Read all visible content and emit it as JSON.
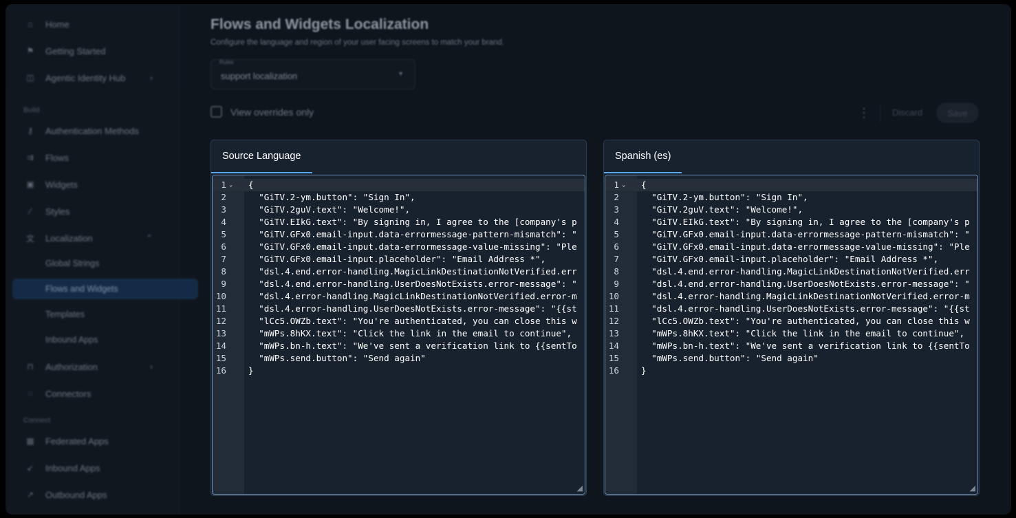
{
  "sidebar": {
    "items": [
      {
        "label": "Home",
        "icon": "home-icon"
      },
      {
        "label": "Getting Started",
        "icon": "flag-icon"
      },
      {
        "label": "Agentic Identity Hub",
        "icon": "agent-icon",
        "chevron": "›"
      },
      {
        "label": "Build",
        "section": true
      },
      {
        "label": "Authentication Methods",
        "icon": "key-icon"
      },
      {
        "label": "Flows",
        "icon": "flows-icon"
      },
      {
        "label": "Widgets",
        "icon": "widget-icon"
      },
      {
        "label": "Styles",
        "icon": "brush-icon"
      },
      {
        "label": "Localization",
        "icon": "translate-icon",
        "chevron": "⌃"
      },
      {
        "label": "Global Strings",
        "sub": true
      },
      {
        "label": "Flows and Widgets",
        "sub": true,
        "active": true
      },
      {
        "label": "Templates",
        "sub": true
      },
      {
        "label": "Inbound Apps",
        "sub": true
      },
      {
        "label": "Authorization",
        "icon": "lock-icon",
        "chevron": "›"
      },
      {
        "label": "Connectors",
        "icon": "plug-icon"
      },
      {
        "label": "Connect",
        "section": true
      },
      {
        "label": "Federated Apps",
        "icon": "grid-icon"
      },
      {
        "label": "Inbound Apps",
        "icon": "arrow-in-icon"
      },
      {
        "label": "Outbound Apps",
        "icon": "arrow-out-icon"
      }
    ]
  },
  "header": {
    "title": "Flows and Widgets Localization",
    "subtitle": "Configure the language and region of your user facing screens to match your brand."
  },
  "select": {
    "label": "Rules",
    "value": "support localization"
  },
  "toolbar": {
    "view_overrides_label": "View overrides only",
    "discard_label": "Discard",
    "save_label": "Save"
  },
  "panels": {
    "source": {
      "title": "Source Language"
    },
    "target": {
      "title": "Spanish (es)"
    }
  },
  "code": {
    "lines": [
      "{",
      "  \"GiTV.2-ym.button\": \"Sign In\",",
      "  \"GiTV.2guV.text\": \"Welcome!\",",
      "  \"GiTV.EIkG.text\": \"By signing in, I agree to the [company's p",
      "  \"GiTV.GFx0.email-input.data-errormessage-pattern-mismatch\": \"",
      "  \"GiTV.GFx0.email-input.data-errormessage-value-missing\": \"Ple",
      "  \"GiTV.GFx0.email-input.placeholder\": \"Email Address *\",",
      "  \"dsl.4.end.error-handling.MagicLinkDestinationNotVerified.err",
      "  \"dsl.4.end.error-handling.UserDoesNotExists.error-message\": \"",
      "  \"dsl.4.error-handling.MagicLinkDestinationNotVerified.error-m",
      "  \"dsl.4.error-handling.UserDoesNotExists.error-message\": \"{{st",
      "  \"lCc5.OWZb.text\": \"You're authenticated, you can close this w",
      "  \"mWPs.8hKX.text\": \"Click the link in the email to continue\",",
      "  \"mWPs.bn-h.text\": \"We've sent a verification link to {{sentTo",
      "  \"mWPs.send.button\": \"Send again\"",
      "}"
    ],
    "line_numbers": [
      "1",
      "2",
      "3",
      "4",
      "5",
      "6",
      "7",
      "8",
      "9",
      "10",
      "11",
      "12",
      "13",
      "14",
      "15",
      "16"
    ],
    "fold_glyph": "⌄"
  }
}
